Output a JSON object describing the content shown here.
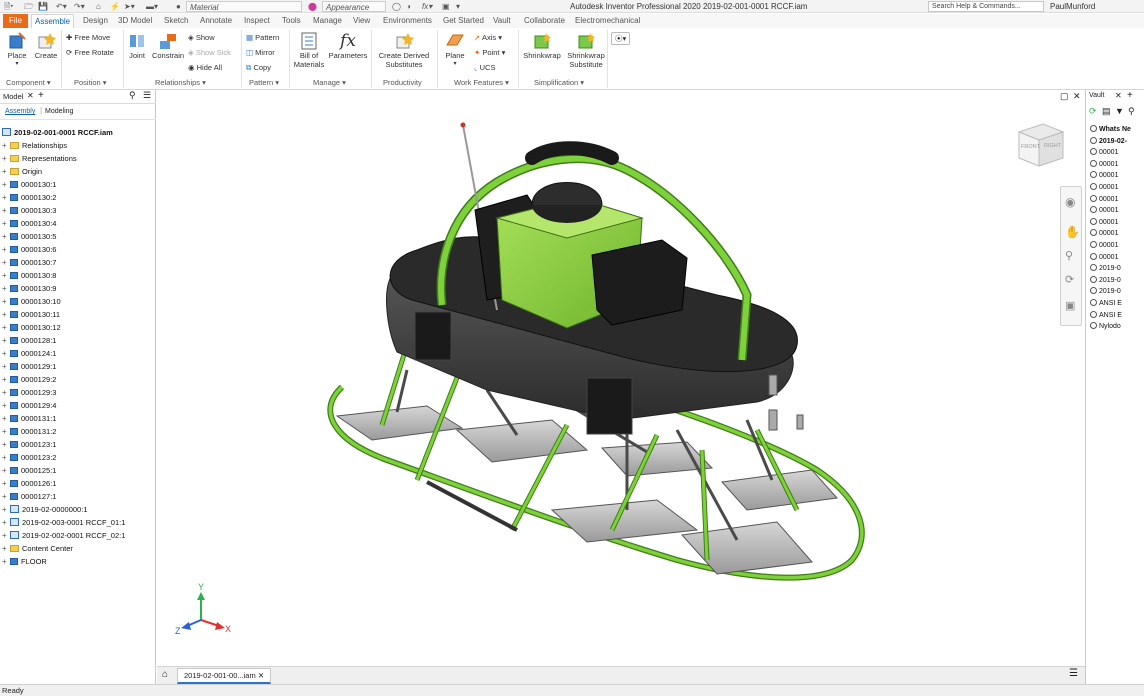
{
  "titlebar": {
    "app_title": "Autodesk Inventor Professional 2020   2019-02-001-0001 RCCF.iam",
    "material_placeholder": "Material",
    "appearance_placeholder": "Appearance",
    "search_placeholder": "Search Help & Commands...",
    "user": "PaulMunford"
  },
  "tabs": [
    "File",
    "Assemble",
    "Design",
    "3D Model",
    "Sketch",
    "Annotate",
    "Inspect",
    "Tools",
    "Manage",
    "View",
    "Environments",
    "Get Started",
    "Vault",
    "Collaborate",
    "Electromechanical"
  ],
  "active_tab": "Assemble",
  "ribbon": {
    "component": {
      "place": "Place",
      "create": "Create",
      "label": "Component ▾"
    },
    "position": {
      "free_move": "Free Move",
      "free_rotate": "Free Rotate",
      "label": "Position ▾"
    },
    "relationships": {
      "joint": "Joint",
      "constrain": "Constrain",
      "show": "Show",
      "show_sick": "Show Sick",
      "hide_all": "Hide All",
      "label": "Relationships ▾"
    },
    "pattern": {
      "pattern": "Pattern",
      "mirror": "Mirror",
      "copy": "Copy",
      "label": "Pattern ▾"
    },
    "manage": {
      "bom": "Bill of Materials",
      "parameters": "Parameters",
      "label": "Manage ▾"
    },
    "productivity": {
      "create_derived": "Create Derived Substitutes",
      "label": "Productivity"
    },
    "work_features": {
      "plane": "Plane",
      "axis": "Axis",
      "point": "Point",
      "ucs": "UCS",
      "label": "Work Features ▾"
    },
    "simplification": {
      "shrinkwrap": "Shrinkwrap",
      "shrinkwrap_sub": "Shrinkwrap Substitute",
      "label": "Simplification ▾"
    }
  },
  "browser": {
    "title": "Model",
    "subtabs": [
      "Assembly",
      "Modeling"
    ],
    "root": "2019-02-001-0001 RCCF.iam",
    "items": [
      {
        "label": "Relationships",
        "type": "folder"
      },
      {
        "label": "Representations",
        "type": "folder"
      },
      {
        "label": "Origin",
        "type": "folder"
      },
      {
        "label": "0000130:1",
        "type": "part"
      },
      {
        "label": "0000130:2",
        "type": "part"
      },
      {
        "label": "0000130:3",
        "type": "part"
      },
      {
        "label": "0000130:4",
        "type": "part"
      },
      {
        "label": "0000130:5",
        "type": "part"
      },
      {
        "label": "0000130:6",
        "type": "part"
      },
      {
        "label": "0000130:7",
        "type": "part"
      },
      {
        "label": "0000130:8",
        "type": "part"
      },
      {
        "label": "0000130:9",
        "type": "part"
      },
      {
        "label": "0000130:10",
        "type": "part"
      },
      {
        "label": "0000130:11",
        "type": "part"
      },
      {
        "label": "0000130:12",
        "type": "part"
      },
      {
        "label": "0000128:1",
        "type": "part"
      },
      {
        "label": "0000124:1",
        "type": "part"
      },
      {
        "label": "0000129:1",
        "type": "part"
      },
      {
        "label": "0000129:2",
        "type": "part"
      },
      {
        "label": "0000129:3",
        "type": "part"
      },
      {
        "label": "0000129:4",
        "type": "part"
      },
      {
        "label": "0000131:1",
        "type": "part"
      },
      {
        "label": "0000131:2",
        "type": "part"
      },
      {
        "label": "0000123:1",
        "type": "part"
      },
      {
        "label": "0000123:2",
        "type": "part"
      },
      {
        "label": "0000125:1",
        "type": "part"
      },
      {
        "label": "0000126:1",
        "type": "part"
      },
      {
        "label": "0000127:1",
        "type": "part"
      },
      {
        "label": "2019-02-0000000:1",
        "type": "assembly"
      },
      {
        "label": "2019-02-003-0001 RCCF_01:1",
        "type": "assembly"
      },
      {
        "label": "2019-02-002-0001 RCCF_02:1",
        "type": "assembly"
      },
      {
        "label": "Content Center",
        "type": "folder"
      },
      {
        "label": "FLOOR",
        "type": "part"
      }
    ]
  },
  "viewcube": {
    "front": "FRONT",
    "right": "RIGHT"
  },
  "triad": {
    "x": "X",
    "y": "Y",
    "z": "Z"
  },
  "doc_tab": "2019-02-001-00...iam",
  "vault": {
    "title": "Vault",
    "items": [
      "Whats Ne",
      "2019-02-",
      "00001",
      "00001",
      "00001",
      "00001",
      "00001",
      "00001",
      "00001",
      "00001",
      "00001",
      "00001",
      "2019-0",
      "2019-0",
      "2019-0",
      "ANSI E",
      "ANSI E",
      "Nylodo"
    ]
  },
  "status": "Ready",
  "colors": {
    "accent": "#e96a17",
    "green": "#8fd33a",
    "tube": "#6bc82a",
    "body": "#3d3d3d"
  }
}
